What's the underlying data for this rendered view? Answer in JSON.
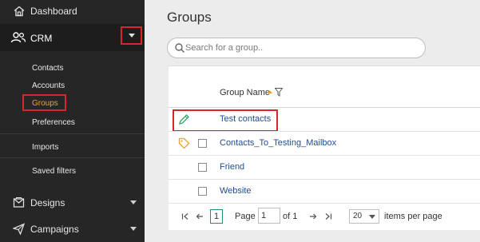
{
  "sidebar": {
    "dashboard": {
      "label": "Dashboard",
      "icon": "home-icon"
    },
    "crm": {
      "label": "CRM",
      "icon": "users-icon"
    },
    "crm_submenu": [
      "Contacts",
      "Accounts",
      "Groups",
      "Preferences",
      "Imports",
      "Saved filters"
    ],
    "active_item": "Groups",
    "designs": {
      "label": "Designs",
      "icon": "envelope-icon"
    },
    "campaigns": {
      "label": "Campaigns",
      "icon": "paper-plane-icon"
    }
  },
  "main": {
    "title": "Groups",
    "search_placeholder": "Search for a group..",
    "table": {
      "column_header": "Group Name",
      "rows": [
        {
          "name": "Test contacts",
          "icon": "pencil-icon"
        },
        {
          "name": "Contacts_To_Testing_Mailbox",
          "icon": "tag-icon"
        },
        {
          "name": "Friend"
        },
        {
          "name": "Website"
        }
      ]
    },
    "pagination": {
      "current_page": "1",
      "page_label": "Page",
      "page_input": "1",
      "of_label": "of 1",
      "per_page_value": "20",
      "per_page_label": "items per page"
    }
  },
  "colors": {
    "sidebar_bg": "#262626",
    "accent_orange": "#f0a030",
    "highlight_red": "#d9262b",
    "link_blue": "#1f4e8c"
  }
}
